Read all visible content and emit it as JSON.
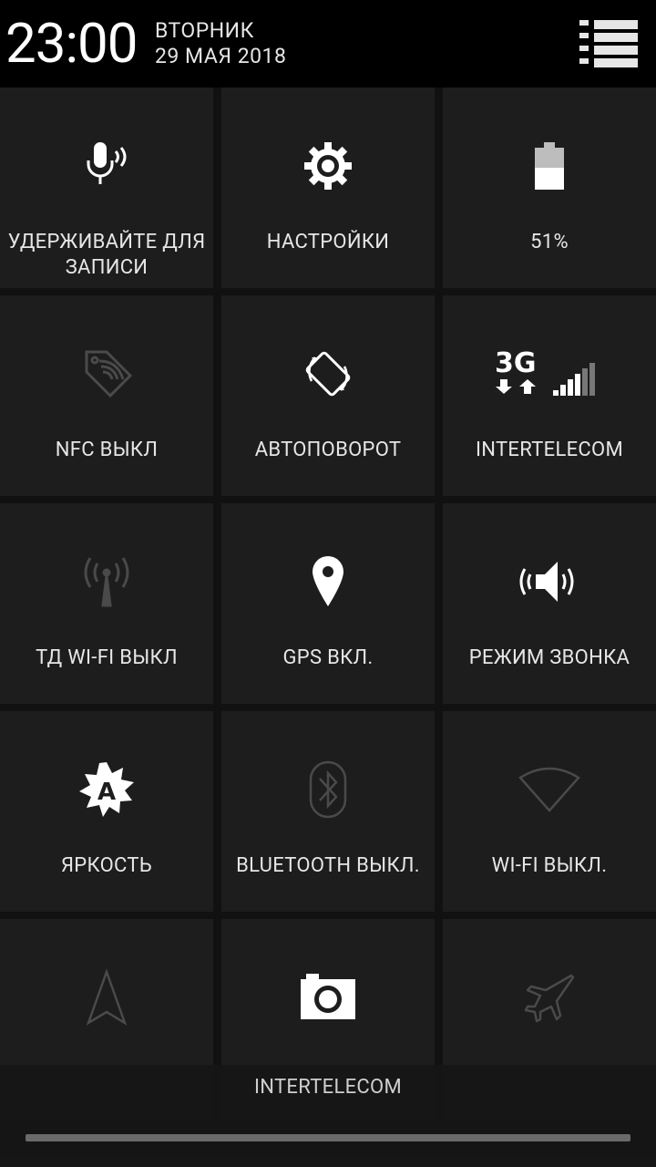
{
  "status": {
    "time": "23:00",
    "weekday": "ВТОРНИК",
    "date": "29 МАЯ 2018"
  },
  "tiles": [
    {
      "label": "УДЕРЖИВАЙТЕ ДЛЯ ЗАПИСИ",
      "icon": "microphone-icon",
      "active": true
    },
    {
      "label": "НАСТРОЙКИ",
      "icon": "gear-icon",
      "active": true
    },
    {
      "label": "51%",
      "icon": "battery-icon",
      "active": true,
      "level_percent": 51
    },
    {
      "label": "NFC ВЫКЛ",
      "icon": "nfc-icon",
      "active": false
    },
    {
      "label": "АВТОПОВОРОТ",
      "icon": "auto-rotate-icon",
      "active": true
    },
    {
      "label": "INTERTELECOM",
      "icon": "mobile-3g-signal-icon",
      "active": true
    },
    {
      "label": "ТД WI-FI ВЫКЛ",
      "icon": "hotspot-icon",
      "active": false
    },
    {
      "label": "GPS ВКЛ.",
      "icon": "location-pin-icon",
      "active": true
    },
    {
      "label": "РЕЖИМ ЗВОНКА",
      "icon": "ringer-volume-icon",
      "active": true
    },
    {
      "label": "ЯРКОСТЬ",
      "icon": "brightness-auto-icon",
      "active": true
    },
    {
      "label": "BLUETOOTH ВЫКЛ.",
      "icon": "bluetooth-icon",
      "active": false
    },
    {
      "label": "WI-FI ВЫКЛ.",
      "icon": "wifi-icon",
      "active": false
    },
    {
      "label": "",
      "icon": "navigation-arrow-icon",
      "active": false
    },
    {
      "label": "",
      "icon": "camera-icon",
      "active": true
    },
    {
      "label": "",
      "icon": "airplane-icon",
      "active": false
    }
  ],
  "bottom": {
    "carrier": "INTERTELECOM"
  },
  "colors": {
    "active_icon": "#ffffff",
    "inactive_icon": "#4a4a4a",
    "tile_bg": "#1d1d1d"
  }
}
